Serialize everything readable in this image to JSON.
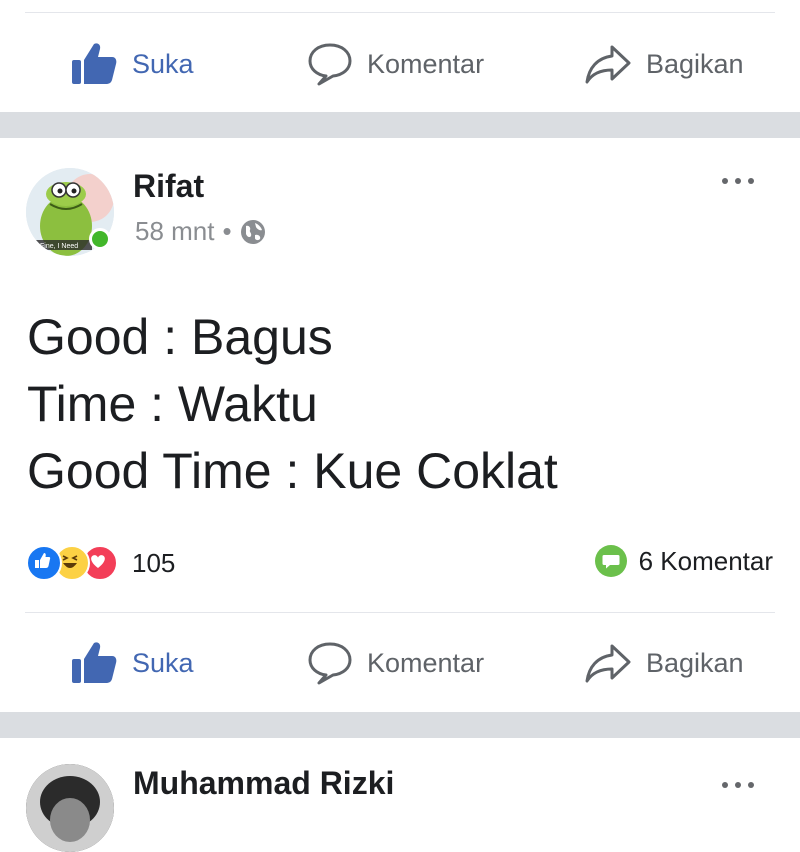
{
  "top_action_bar": {
    "like_label": "Suka",
    "comment_label": "Komentar",
    "share_label": "Bagikan"
  },
  "post": {
    "author": "Rifat",
    "time": "58 mnt",
    "meta_separator": "•",
    "avatar_caption": "Fine, I Need",
    "lines": [
      "Good : Bagus",
      "Time : Waktu",
      "Good Time : Kue Coklat"
    ],
    "reaction_count": "105",
    "comments_count": "6 Komentar",
    "reactions": [
      "like-icon",
      "haha-icon",
      "love-icon"
    ],
    "actions": {
      "like_label": "Suka",
      "comment_label": "Komentar",
      "share_label": "Bagikan"
    }
  },
  "next_post": {
    "author": "Muhammad Rizki"
  },
  "colors": {
    "brand_blue": "#4267b2",
    "muted_text": "#8a8d91",
    "separator": "#dadde1",
    "online_green": "#42b72a",
    "comment_badge": "#6bc04b",
    "love_red": "#f33e58",
    "haha_yellow": "#fcd144"
  }
}
